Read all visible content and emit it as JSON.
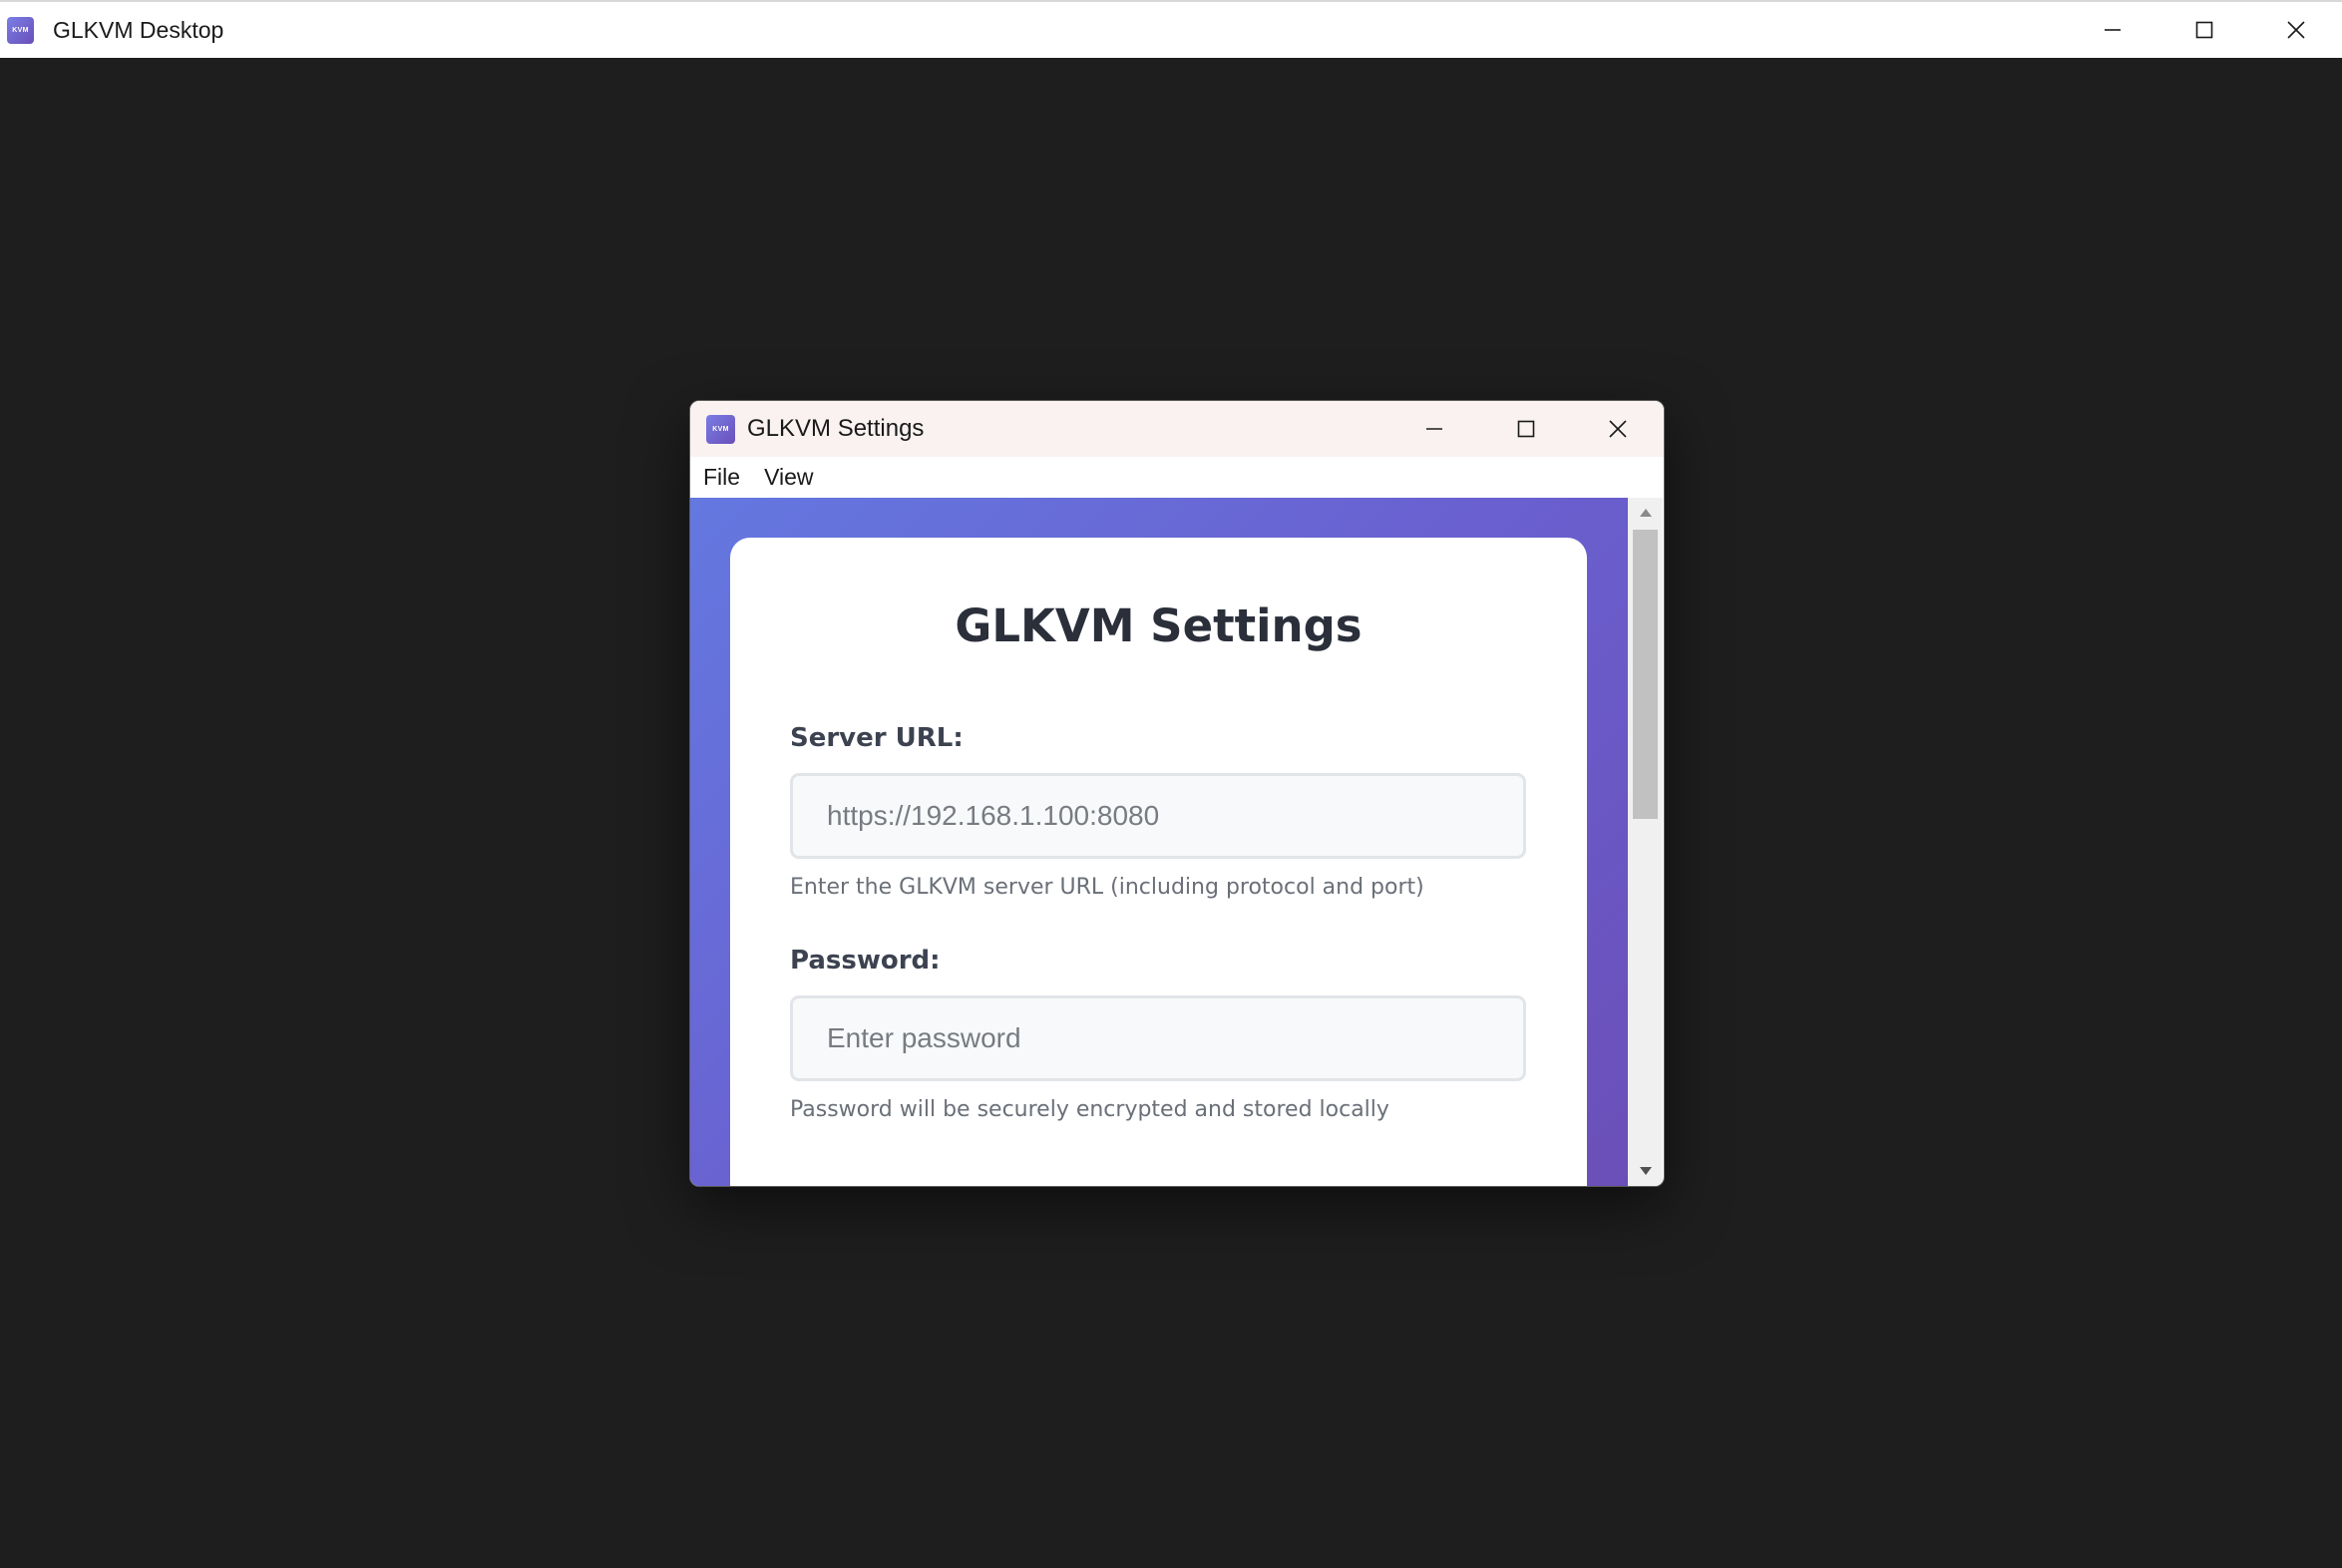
{
  "main_window": {
    "title": "GLKVM Desktop",
    "icon_label": "KVM",
    "controls": [
      "minimize-icon",
      "maximize-icon",
      "close-icon"
    ]
  },
  "settings_dialog": {
    "title": "GLKVM Settings",
    "icon_label": "KVM",
    "menu": [
      {
        "label": "File"
      },
      {
        "label": "View"
      }
    ],
    "card": {
      "heading": "GLKVM Settings",
      "server_url": {
        "label": "Server URL:",
        "placeholder": "https://192.168.1.100:8080",
        "value": "",
        "hint": "Enter the GLKVM server URL (including protocol and port)"
      },
      "password": {
        "label": "Password:",
        "placeholder": "Enter password",
        "value": "",
        "hint": "Password will be securely encrypted and stored locally"
      }
    }
  },
  "colors": {
    "desktop_background": "#1e1e1e",
    "gradient_start": "#6478e0",
    "gradient_end": "#6b4fb8",
    "dialog_titlebar": "#f9f2f1"
  }
}
